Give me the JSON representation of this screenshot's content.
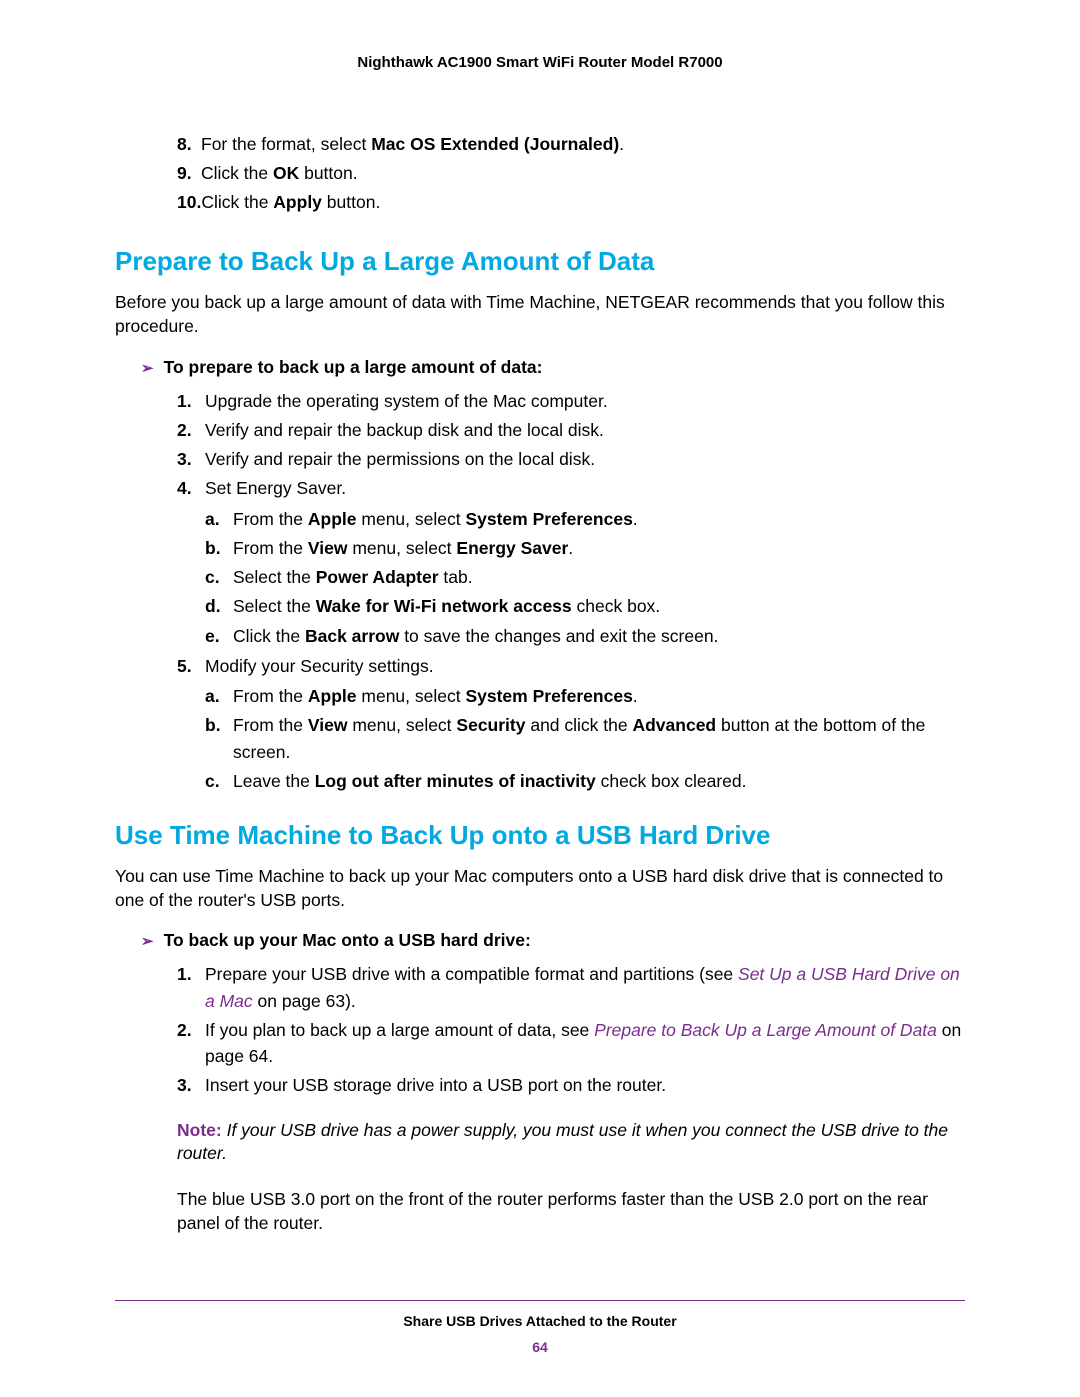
{
  "header": "Nighthawk AC1900 Smart WiFi Router Model R7000",
  "topList": {
    "item8": {
      "num": "8.",
      "pre": "For the format, select ",
      "bold": "Mac OS Extended (Journaled)",
      "post": "."
    },
    "item9": {
      "num": "9.",
      "pre": "Click the ",
      "bold": "OK",
      "post": " button."
    },
    "item10": {
      "num": "10.",
      "pre": "Click the ",
      "bold": "Apply",
      "post": " button."
    }
  },
  "section1": {
    "heading": "Prepare to Back Up a Large Amount of Data",
    "intro": "Before you back up a large amount of data with Time Machine, NETGEAR recommends that you follow this procedure.",
    "subhead": "To prepare to back up a large amount of data:",
    "steps": {
      "s1": {
        "num": "1.",
        "text": "Upgrade the operating system of the Mac computer."
      },
      "s2": {
        "num": "2.",
        "text": "Verify and repair the backup disk and the local disk."
      },
      "s3": {
        "num": "3.",
        "text": "Verify and repair the permissions on the local disk."
      },
      "s4": {
        "num": "4.",
        "text": "Set Energy Saver."
      },
      "s4a": {
        "num": "a.",
        "p1": "From the ",
        "b1": "Apple",
        "p2": " menu, select ",
        "b2": "System Preferences",
        "p3": "."
      },
      "s4b": {
        "num": "b.",
        "p1": "From the ",
        "b1": "View",
        "p2": " menu, select ",
        "b2": "Energy Saver",
        "p3": "."
      },
      "s4c": {
        "num": "c.",
        "p1": "Select the ",
        "b1": "Power Adapter",
        "p2": " tab."
      },
      "s4d": {
        "num": "d.",
        "p1": "Select the ",
        "b1": "Wake for Wi-Fi network access",
        "p2": " check box."
      },
      "s4e": {
        "num": "e.",
        "p1": "Click the ",
        "b1": "Back arrow",
        "p2": " to save the changes and exit the screen."
      },
      "s5": {
        "num": "5.",
        "text": "Modify your Security settings."
      },
      "s5a": {
        "num": "a.",
        "p1": "From the ",
        "b1": "Apple",
        "p2": " menu, select ",
        "b2": "System Preferences",
        "p3": "."
      },
      "s5b": {
        "num": "b.",
        "p1": "From the ",
        "b1": "View",
        "p2": " menu, select ",
        "b2": "Security",
        "p3": " and click the ",
        "b3": "Advanced",
        "p4": " button at the bottom of the screen."
      },
      "s5c": {
        "num": "c.",
        "p1": "Leave the ",
        "b1": "Log out after minutes of inactivity",
        "p2": " check box cleared."
      }
    }
  },
  "section2": {
    "heading": "Use Time Machine to Back Up onto a USB Hard Drive",
    "intro": "You can use Time Machine to back up your Mac computers onto a USB hard disk drive that is connected to one of the router's USB ports.",
    "subhead": "To back up your Mac onto a USB hard drive:",
    "steps": {
      "s1": {
        "num": "1.",
        "pre": "Prepare your USB drive with a compatible format and partitions (see ",
        "link": "Set Up a USB Hard Drive on a Mac",
        "post": " on page 63)."
      },
      "s2": {
        "num": "2.",
        "pre": "If you plan to back up a large amount of data, see ",
        "link": "Prepare to Back Up a Large Amount of Data",
        "post": " on page 64."
      },
      "s3": {
        "num": "3.",
        "text": "Insert your USB storage drive into a USB port on the router."
      }
    },
    "note": {
      "label": "Note:  ",
      "text": "If your USB drive has a power supply, you must use it when you connect the USB drive to the router."
    },
    "afterNote": "The blue USB 3.0 port on the front of the router performs faster than the USB 2.0 port on the rear panel of the router."
  },
  "footer": {
    "text": "Share USB Drives Attached to the Router",
    "page": "64"
  },
  "arrow": "➢"
}
